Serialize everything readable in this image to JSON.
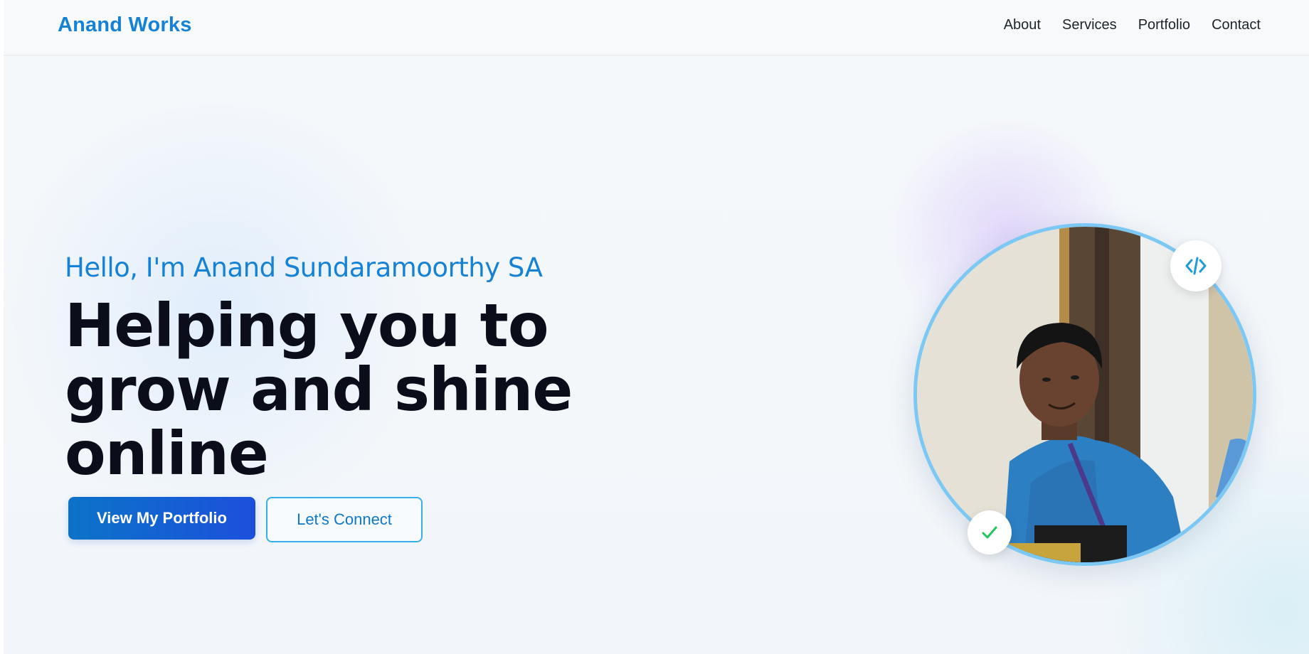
{
  "nav": {
    "brand": "Anand Works",
    "links": [
      "About",
      "Services",
      "Portfolio",
      "Contact"
    ]
  },
  "hero": {
    "greeting": "Hello, I'm Anand Sundaramoorthy SA",
    "headline_lines": [
      "Helping you to",
      "grow and shine",
      "online"
    ],
    "primary_cta": "View My Portfolio",
    "secondary_cta": "Let's Connect"
  },
  "badges": {
    "top_icon": "code-icon",
    "bottom_icon": "check-icon"
  },
  "colors": {
    "brand": "#1682d6",
    "headline": "#0b0d1a",
    "primary_gradient_start": "#0c73c9",
    "primary_gradient_end": "#1c50dc",
    "portrait_ring": "#7cc8f4",
    "check": "#22c55e"
  }
}
